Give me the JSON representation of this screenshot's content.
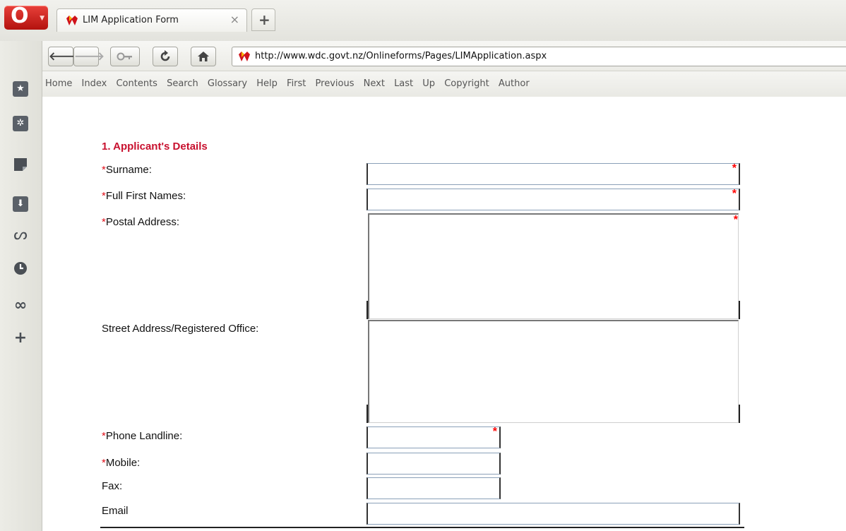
{
  "tab": {
    "title": "LIM Application Form",
    "close_glyph": "×",
    "new_tab_glyph": "+"
  },
  "address_bar": {
    "url": "http://www.wdc.govt.nz/Onlineforms/Pages/LIMApplication.aspx"
  },
  "nav_links": [
    "Home",
    "Index",
    "Contents",
    "Search",
    "Glossary",
    "Help",
    "First",
    "Previous",
    "Next",
    "Last",
    "Up",
    "Copyright",
    "Author"
  ],
  "sidebar_icons": [
    "bookmarks-icon",
    "widgets-icon",
    "notes-icon",
    "downloads-icon",
    "links-icon",
    "history-icon",
    "unite-icon",
    "add-panel-icon"
  ],
  "form": {
    "section_title": "1. Applicant's Details",
    "required_mark": "*",
    "fields": {
      "surname": {
        "label": "Surname:",
        "required": true,
        "value": ""
      },
      "first_names": {
        "label": "Full First Names:",
        "required": true,
        "value": ""
      },
      "postal_address": {
        "label": "Postal Address:",
        "required": true,
        "value": ""
      },
      "street_address": {
        "label": "Street Address/Registered Office:",
        "required": false,
        "value": ""
      },
      "phone_landline": {
        "label": "Phone Landline:",
        "required": true,
        "value": ""
      },
      "mobile": {
        "label": "Mobile:",
        "required": true,
        "value": ""
      },
      "fax": {
        "label": "Fax:",
        "required": false,
        "value": ""
      },
      "email": {
        "label": "Email",
        "required": false,
        "value": ""
      }
    }
  },
  "colors": {
    "section_title": "#c8102e",
    "required_star": "#ff0000",
    "opera_red": "#cc1b16"
  }
}
